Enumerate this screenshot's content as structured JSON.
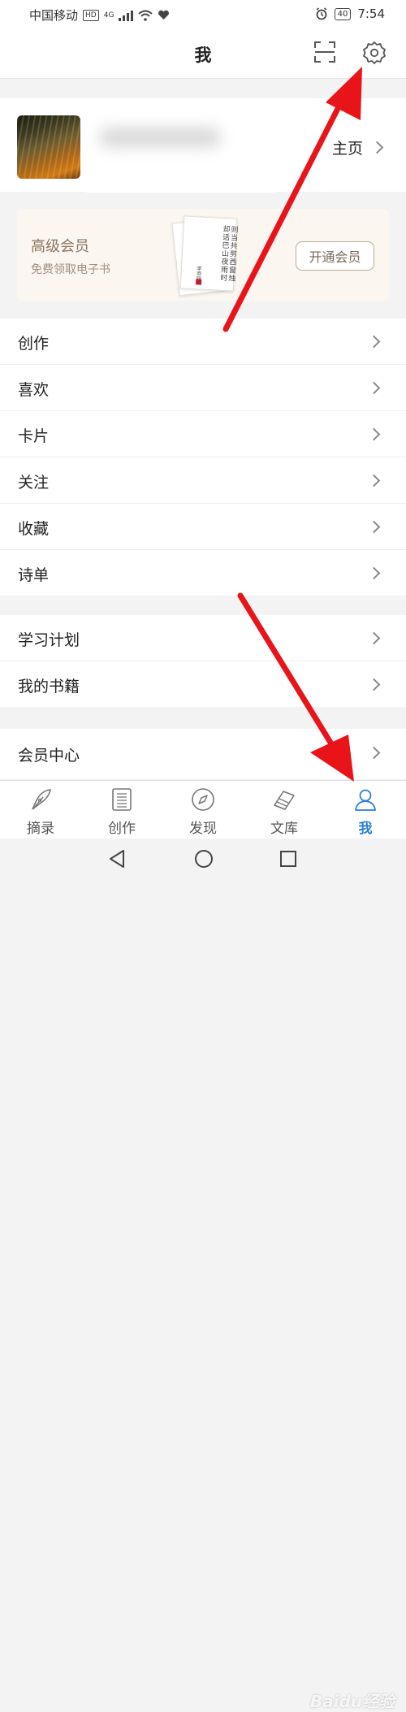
{
  "status_bar": {
    "carrier": "中国移动",
    "hd": "HD",
    "network": "4G",
    "battery": "40",
    "time": "7:54"
  },
  "header": {
    "title": "我"
  },
  "profile": {
    "homepage_link": "主页"
  },
  "vip": {
    "title": "高级会员",
    "subtitle": "免费领取电子书",
    "button": "开通会员",
    "book_text": "则当共剪西窗烛却话巴山夜雨时",
    "book_author": "李商隐"
  },
  "menu_group1": [
    {
      "label": "创作"
    },
    {
      "label": "喜欢"
    },
    {
      "label": "卡片"
    },
    {
      "label": "关注"
    },
    {
      "label": "收藏"
    },
    {
      "label": "诗单"
    }
  ],
  "menu_group2": [
    {
      "label": "学习计划"
    },
    {
      "label": "我的书籍"
    }
  ],
  "menu_group3": [
    {
      "label": "会员中心"
    }
  ],
  "tabbar": {
    "items": [
      {
        "label": "摘录",
        "icon": "quill-icon"
      },
      {
        "label": "创作",
        "icon": "document-icon"
      },
      {
        "label": "发现",
        "icon": "compass-icon"
      },
      {
        "label": "文库",
        "icon": "books-icon"
      },
      {
        "label": "我",
        "icon": "person-icon"
      }
    ],
    "active_index": 4
  },
  "colors": {
    "accent": "#2d7fd3",
    "arrow": "#e8141a",
    "vip_background": "#fcf6f1"
  },
  "watermark": "Baidu经验"
}
